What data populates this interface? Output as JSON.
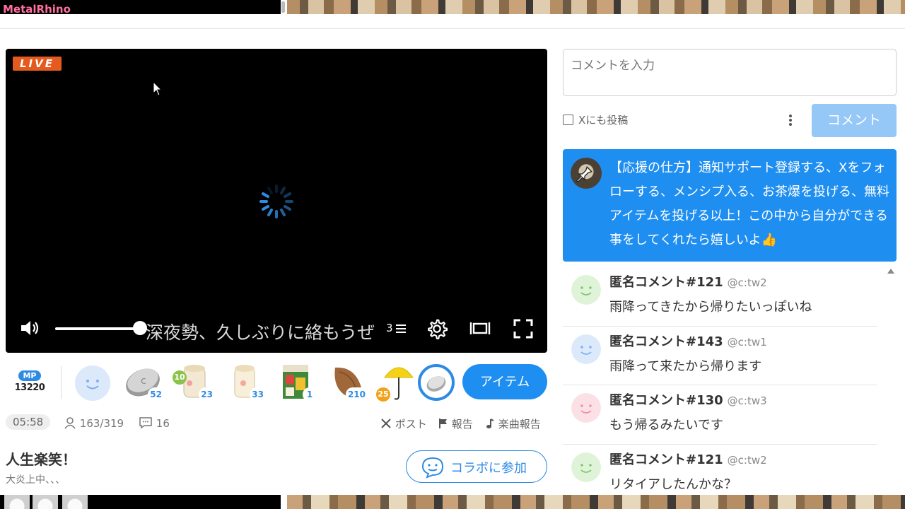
{
  "top": {
    "brand": "MetalRhino"
  },
  "player": {
    "live_label": "LIVE",
    "overlay_text": "深夜勢、久しぶりに絡もうぜ",
    "cc_label": "3"
  },
  "items": {
    "mp_badge": "MP",
    "mp_value": "13220",
    "gifts": [
      {
        "icon": "smile-face-icon",
        "count": ""
      },
      {
        "icon": "silver-coin-icon",
        "count": "52"
      },
      {
        "icon": "rice-cake-icon",
        "count": "23",
        "level": "10"
      },
      {
        "icon": "tofu-icon",
        "count": "33"
      },
      {
        "icon": "magazine-icon",
        "count": "1"
      },
      {
        "icon": "almond-icon",
        "count": "210"
      },
      {
        "icon": "umbrella-icon",
        "count": "",
        "level": "25"
      },
      {
        "icon": "coin-ring-icon",
        "count": ""
      }
    ],
    "item_button": "アイテム"
  },
  "stats": {
    "elapsed": "05:58",
    "viewers": "163/319",
    "comments": "16",
    "post": "ポスト",
    "report": "報告",
    "music_report": "楽曲報告"
  },
  "stream": {
    "title": "人生楽笑！",
    "description": "大炎上中、、、",
    "collab_button": "コラボに参加"
  },
  "comment_form": {
    "placeholder": "コメントを入力",
    "x_post_label": "Xにも投稿",
    "submit_label": "コメント"
  },
  "pinned": {
    "text": "【応援の仕方】通知サポート登録する、Xをフォローする、メンシプ入る、お茶爆を投げる、無料アイテムを投げる以上！この中から自分ができる事をしてくれたら嬉しいよ👍"
  },
  "comments": [
    {
      "name": "匿名コメント#121",
      "handle": "@c:tw2",
      "text": "雨降ってきたから帰りたいっぽいね",
      "avatar_color": "#dff3d8",
      "face_color": "#7dc86a"
    },
    {
      "name": "匿名コメント#143",
      "handle": "@c:tw1",
      "text": "雨降って来たから帰ります",
      "avatar_color": "#dbe9fb",
      "face_color": "#7eaef0"
    },
    {
      "name": "匿名コメント#130",
      "handle": "@c:tw3",
      "text": "もう帰るみたいです",
      "avatar_color": "#fbe0e6",
      "face_color": "#ef8fa8"
    },
    {
      "name": "匿名コメント#121",
      "handle": "@c:tw2",
      "text": "リタイアしたんかな？",
      "avatar_color": "#dff3d8",
      "face_color": "#7dc86a"
    }
  ],
  "colors": {
    "accent": "#1f8ef1",
    "live": "#e55a1e",
    "pinned_bg": "#1f8ef1"
  }
}
